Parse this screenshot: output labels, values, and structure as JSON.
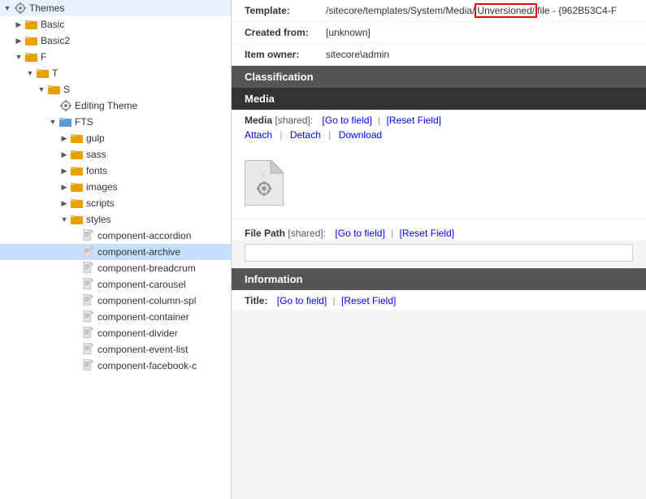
{
  "left_panel": {
    "items": [
      {
        "id": "themes-root",
        "label": "Themes",
        "indent": 0,
        "toggle": "▼",
        "icon": "gear",
        "selected": false
      },
      {
        "id": "basic",
        "label": "Basic",
        "indent": 1,
        "toggle": "▶",
        "icon": "folder-yellow",
        "selected": false
      },
      {
        "id": "basic2",
        "label": "Basic2",
        "indent": 1,
        "toggle": "▶",
        "icon": "folder-yellow",
        "selected": false
      },
      {
        "id": "f",
        "label": "F",
        "indent": 1,
        "toggle": "▼",
        "icon": "folder-yellow",
        "selected": false
      },
      {
        "id": "t",
        "label": "T",
        "indent": 2,
        "toggle": "▼",
        "icon": "folder-yellow",
        "selected": false
      },
      {
        "id": "s",
        "label": "S",
        "indent": 3,
        "toggle": "▼",
        "icon": "folder-yellow",
        "selected": false
      },
      {
        "id": "editing-theme",
        "label": "Editing Theme",
        "indent": 4,
        "toggle": "",
        "icon": "gear",
        "selected": false
      },
      {
        "id": "fts",
        "label": "FTS",
        "indent": 4,
        "toggle": "▼",
        "icon": "folder-blue",
        "selected": false
      },
      {
        "id": "gulp",
        "label": "gulp",
        "indent": 5,
        "toggle": "▶",
        "icon": "folder-yellow",
        "selected": false
      },
      {
        "id": "sass",
        "label": "sass",
        "indent": 5,
        "toggle": "▶",
        "icon": "folder-yellow",
        "selected": false
      },
      {
        "id": "fonts",
        "label": "fonts",
        "indent": 5,
        "toggle": "▶",
        "icon": "folder-yellow",
        "selected": false
      },
      {
        "id": "images",
        "label": "images",
        "indent": 5,
        "toggle": "▶",
        "icon": "folder-yellow",
        "selected": false
      },
      {
        "id": "scripts",
        "label": "scripts",
        "indent": 5,
        "toggle": "▶",
        "icon": "folder-yellow",
        "selected": false
      },
      {
        "id": "styles",
        "label": "styles",
        "indent": 5,
        "toggle": "▼",
        "icon": "folder-yellow",
        "selected": false
      },
      {
        "id": "component-accordion",
        "label": "component-accordion",
        "indent": 6,
        "toggle": "",
        "icon": "page",
        "selected": false
      },
      {
        "id": "component-archive",
        "label": "component-archive",
        "indent": 6,
        "toggle": "",
        "icon": "page",
        "selected": true
      },
      {
        "id": "component-breadcrumb",
        "label": "component-breadcrum",
        "indent": 6,
        "toggle": "",
        "icon": "page",
        "selected": false
      },
      {
        "id": "component-carousel",
        "label": "component-carousel",
        "indent": 6,
        "toggle": "",
        "icon": "page",
        "selected": false
      },
      {
        "id": "component-column-spl",
        "label": "component-column-spl",
        "indent": 6,
        "toggle": "",
        "icon": "page",
        "selected": false
      },
      {
        "id": "component-container",
        "label": "component-container",
        "indent": 6,
        "toggle": "",
        "icon": "page",
        "selected": false
      },
      {
        "id": "component-divider",
        "label": "component-divider",
        "indent": 6,
        "toggle": "",
        "icon": "page",
        "selected": false
      },
      {
        "id": "component-event-list",
        "label": "component-event-list",
        "indent": 6,
        "toggle": "",
        "icon": "page",
        "selected": false
      },
      {
        "id": "component-facebook-c",
        "label": "component-facebook-c",
        "indent": 6,
        "toggle": "",
        "icon": "page",
        "selected": false
      }
    ]
  },
  "right_panel": {
    "template_label": "Template:",
    "template_value_pre": "/sitecore/templates/System/Media/",
    "template_value_highlight": "Unversioned/",
    "template_value_post": "file - {962B53C4-F",
    "created_from_label": "Created from:",
    "created_from_value": "[unknown]",
    "item_owner_label": "Item owner:",
    "item_owner_value": "sitecore\\admin",
    "classification_header": "Classification",
    "media_header": "Media",
    "media_field_label": "Media",
    "shared_badge": "[shared]:",
    "go_to_field": "[Go to field]",
    "reset_field": "[Reset Field]",
    "attach_label": "Attach",
    "detach_label": "Detach",
    "download_label": "Download",
    "file_path_label": "File Path",
    "file_path_shared": "[shared]:",
    "file_path_go_to_field": "[Go to field]",
    "file_path_reset_field": "[Reset Field]",
    "information_header": "Information",
    "title_label": "Title:",
    "title_go_to_field": "[Go to field]",
    "title_reset_field": "[Reset Field]"
  }
}
